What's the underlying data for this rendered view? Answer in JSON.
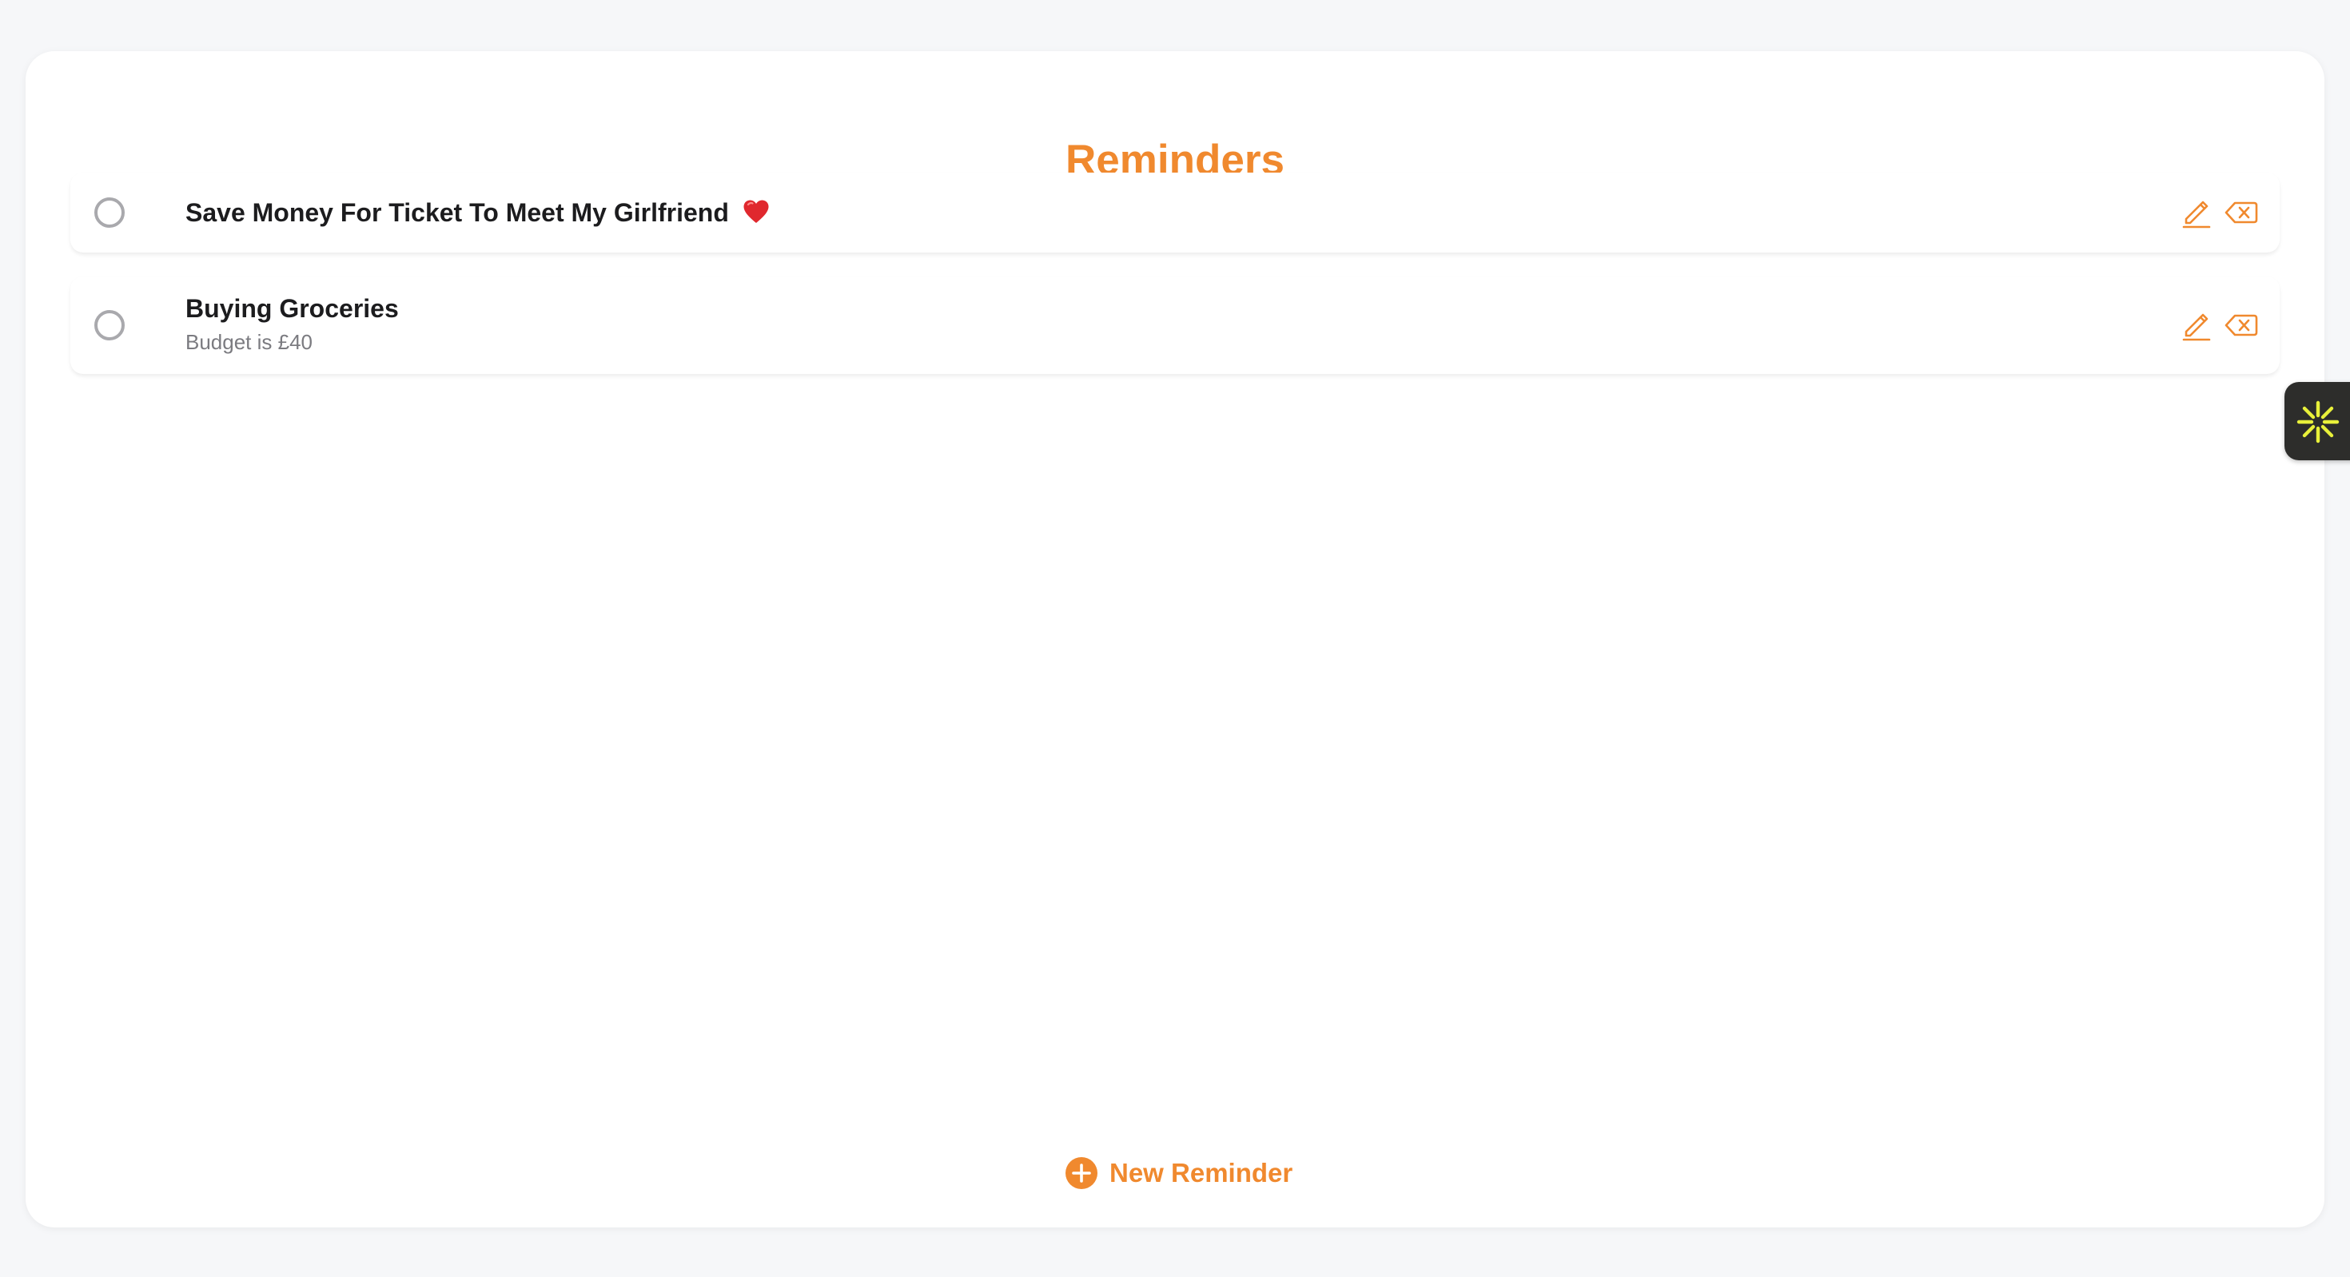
{
  "page": {
    "title": "Reminders",
    "accent_color": "#f0892e"
  },
  "reminders": [
    {
      "title": "Save Money For Ticket To Meet My Girlfriend",
      "emoji_icon": "red-heart-icon",
      "note": "",
      "completed": false
    },
    {
      "title": "Buying Groceries",
      "note": "Budget is £40",
      "completed": false
    }
  ],
  "row_actions": {
    "edit_icon": "pencil-icon",
    "delete_icon": "delete-backspace-icon"
  },
  "footer": {
    "new_reminder_label": "New Reminder",
    "new_reminder_icon": "plus-circle-icon"
  },
  "side_widget": {
    "icon": "sparkle-asterisk-icon",
    "icon_color": "#e8f03a"
  }
}
